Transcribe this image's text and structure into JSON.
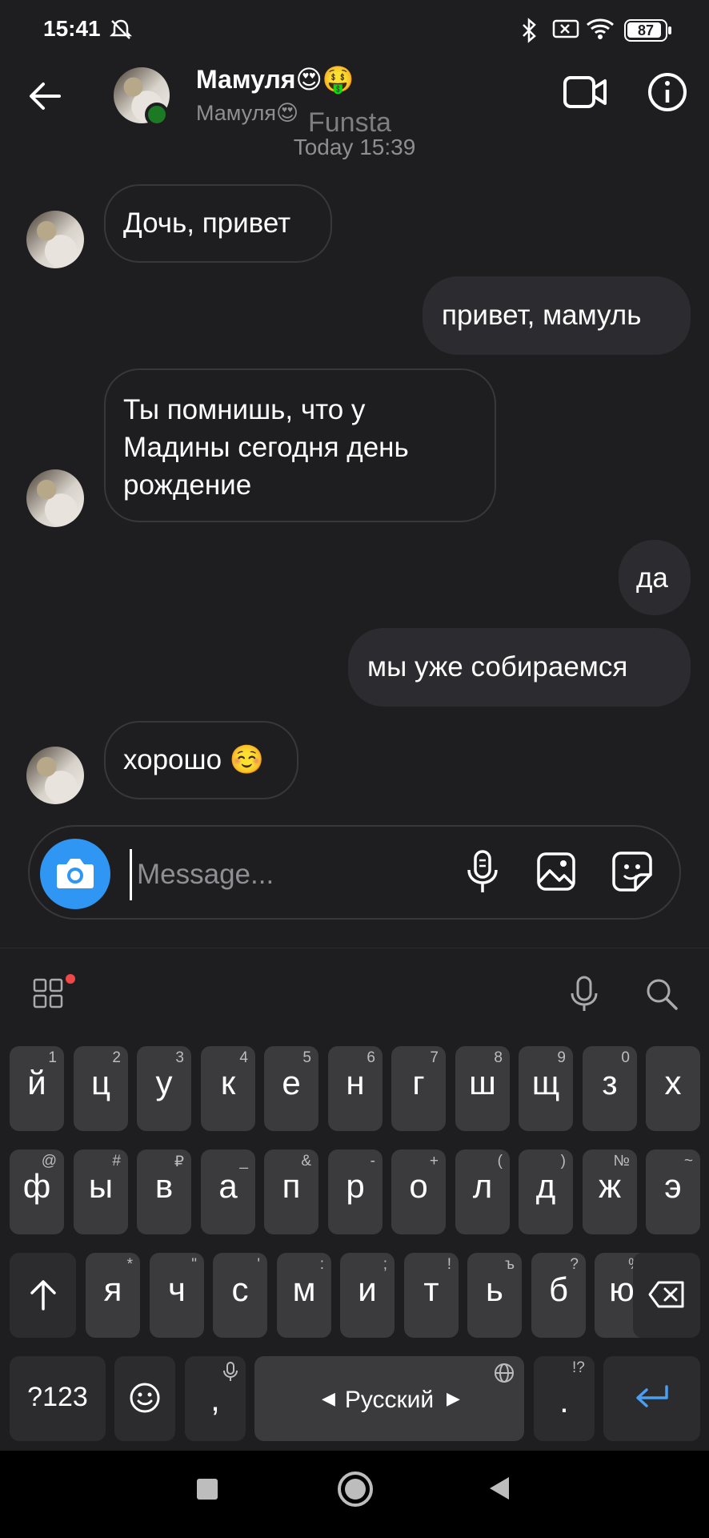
{
  "status_bar": {
    "time": "15:41",
    "battery": "87"
  },
  "header": {
    "contact_name": "Мамуля😍🤑",
    "contact_username": "Мамуля😍",
    "watermark": "Funsta"
  },
  "chat": {
    "timestamp": "Today 15:39",
    "messages": [
      {
        "direction": "in",
        "text": "Дочь, привет"
      },
      {
        "direction": "out",
        "text": "привет, мамуль"
      },
      {
        "direction": "in",
        "text": "Ты помнишь, что у Мадины сегодня день рождение"
      },
      {
        "direction": "out",
        "text": "да"
      },
      {
        "direction": "out",
        "text": "мы уже собираемся"
      },
      {
        "direction": "in",
        "text": "хорошо ☺️"
      }
    ]
  },
  "composer": {
    "placeholder": "Message..."
  },
  "keyboard": {
    "row1": [
      {
        "key": "й",
        "hint": "1"
      },
      {
        "key": "ц",
        "hint": "2"
      },
      {
        "key": "у",
        "hint": "3"
      },
      {
        "key": "к",
        "hint": "4"
      },
      {
        "key": "е",
        "hint": "5"
      },
      {
        "key": "н",
        "hint": "6"
      },
      {
        "key": "г",
        "hint": "7"
      },
      {
        "key": "ш",
        "hint": "8"
      },
      {
        "key": "щ",
        "hint": "9"
      },
      {
        "key": "з",
        "hint": "0"
      },
      {
        "key": "х",
        "hint": ""
      }
    ],
    "row2": [
      {
        "key": "ф",
        "hint": "@"
      },
      {
        "key": "ы",
        "hint": "#"
      },
      {
        "key": "в",
        "hint": "₽"
      },
      {
        "key": "а",
        "hint": "_"
      },
      {
        "key": "п",
        "hint": "&"
      },
      {
        "key": "р",
        "hint": "-"
      },
      {
        "key": "о",
        "hint": "+"
      },
      {
        "key": "л",
        "hint": "("
      },
      {
        "key": "д",
        "hint": ")"
      },
      {
        "key": "ж",
        "hint": "№"
      },
      {
        "key": "э",
        "hint": "~"
      }
    ],
    "row3": [
      {
        "key": "я",
        "hint": "*"
      },
      {
        "key": "ч",
        "hint": "\""
      },
      {
        "key": "с",
        "hint": "'"
      },
      {
        "key": "м",
        "hint": ":"
      },
      {
        "key": "и",
        "hint": ";"
      },
      {
        "key": "т",
        "hint": "!"
      },
      {
        "key": "ь",
        "hint": "ъ"
      },
      {
        "key": "б",
        "hint": "?"
      },
      {
        "key": "ю",
        "hint": "%"
      }
    ],
    "mode_key": "?123",
    "comma_key": ",",
    "space_label": "Русский",
    "period_key": ".",
    "period_hint": "!?"
  },
  "colors": {
    "accent": "#2f96f3",
    "enter": "#4a9ff0",
    "online": "#1d7a24"
  }
}
